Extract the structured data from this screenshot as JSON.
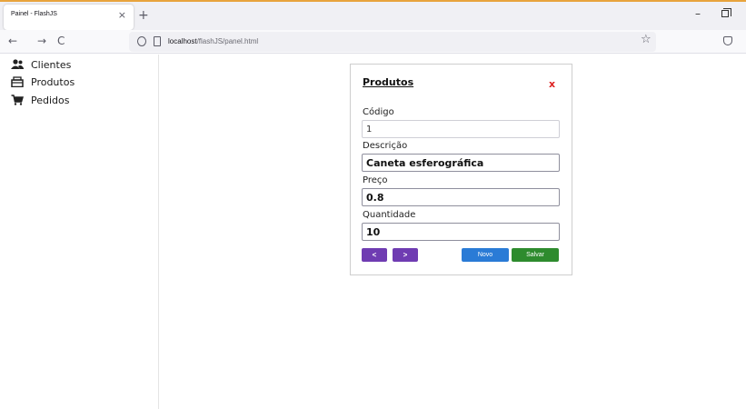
{
  "browser": {
    "tab_title": "Painel - FlashJS",
    "tab_close": "×",
    "new_tab": "+",
    "url_host": "localhost",
    "url_path": "/flashJS/panel.html",
    "back": "←",
    "forward": "→",
    "reload": "C",
    "bookmark": "☆",
    "minimize": "–"
  },
  "sidebar": {
    "items": [
      {
        "label": "Clientes",
        "icon": "users-icon"
      },
      {
        "label": "Produtos",
        "icon": "box-icon"
      },
      {
        "label": "Pedidos",
        "icon": "cart-icon"
      }
    ]
  },
  "panel": {
    "title": "Produtos",
    "close": "x",
    "fields": [
      {
        "label": "Código",
        "value": "1"
      },
      {
        "label": "Descrição",
        "value": "Caneta esferográfica"
      },
      {
        "label": "Preço",
        "value": "0.8"
      },
      {
        "label": "Quantidade",
        "value": "10"
      }
    ],
    "buttons": {
      "prev": "<",
      "next": ">",
      "new": "Novo",
      "save": "Salvar"
    }
  },
  "colors": {
    "nav_button": "#6f3cb2",
    "new_button": "#2a7bd6",
    "save_button": "#2e8b2e",
    "close_x": "#dd2222"
  }
}
